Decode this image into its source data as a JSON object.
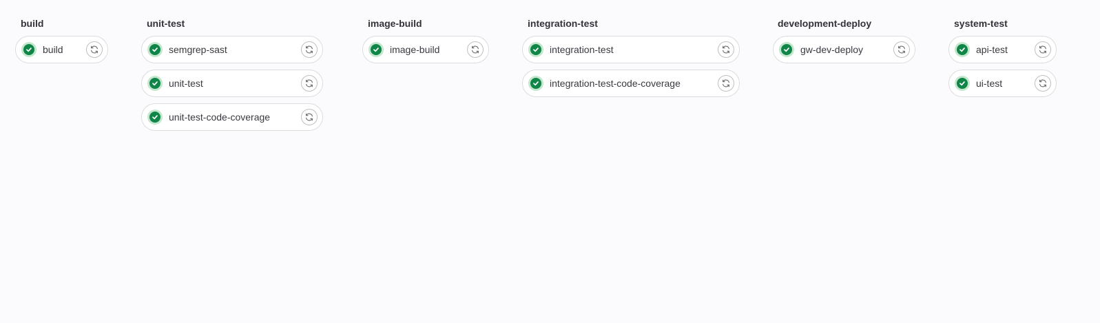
{
  "stages": [
    {
      "title": "build",
      "jobs": [
        {
          "name": "build",
          "status": "success"
        }
      ]
    },
    {
      "title": "unit-test",
      "jobs": [
        {
          "name": "semgrep-sast",
          "status": "success"
        },
        {
          "name": "unit-test",
          "status": "success"
        },
        {
          "name": "unit-test-code-coverage",
          "status": "success"
        }
      ]
    },
    {
      "title": "image-build",
      "jobs": [
        {
          "name": "image-build",
          "status": "success"
        }
      ]
    },
    {
      "title": "integration-test",
      "jobs": [
        {
          "name": "integration-test",
          "status": "success"
        },
        {
          "name": "integration-test-code-coverage",
          "status": "success"
        }
      ]
    },
    {
      "title": "development-deploy",
      "jobs": [
        {
          "name": "gw-dev-deploy",
          "status": "success"
        }
      ]
    },
    {
      "title": "system-test",
      "jobs": [
        {
          "name": "api-test",
          "status": "success"
        },
        {
          "name": "ui-test",
          "status": "success"
        }
      ]
    }
  ],
  "icons": {
    "status": "check-circle-icon",
    "action": "retry-icon"
  },
  "colors": {
    "success": "#108548",
    "success_ring": "#c3e6cd",
    "background": "#fbfbfd",
    "border": "#dcdcde"
  }
}
